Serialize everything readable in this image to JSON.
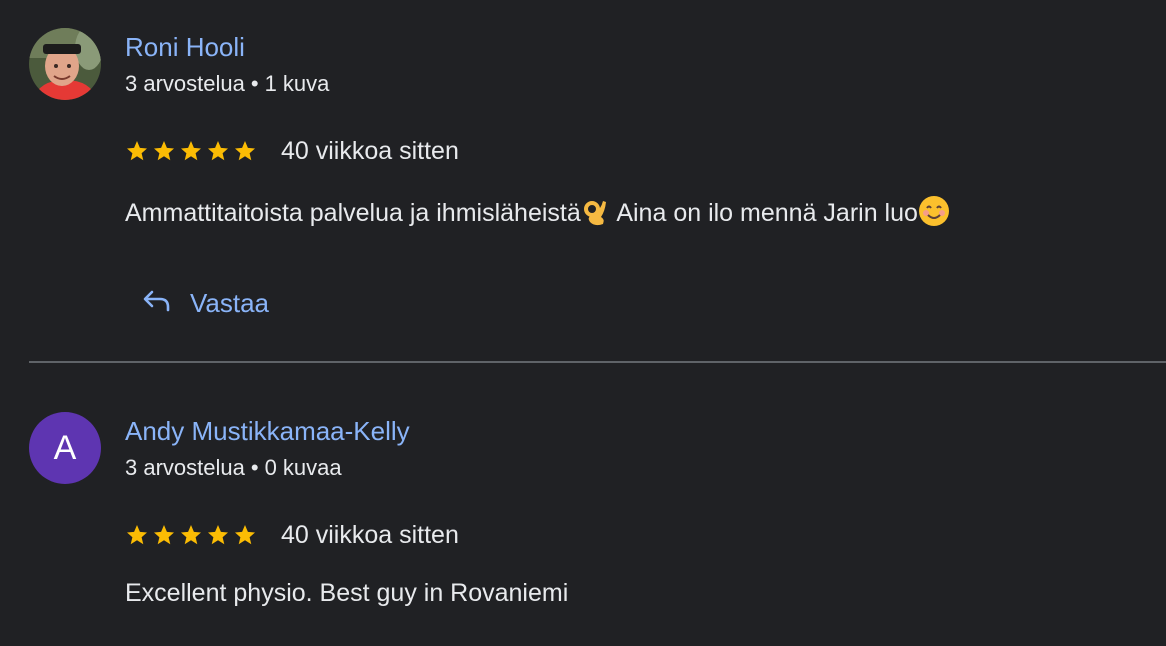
{
  "reviews": [
    {
      "author": "Roni Hooli",
      "reviews_count": "3 arvostelua",
      "separator": "•",
      "photos_count": "1 kuva",
      "rating": 5,
      "date": "40 viikkoa sitten",
      "text_before": "Ammattitaitoista palvelua ja ihmisläheistä",
      "text_mid": " Aina on ilo mennä Jarin luo",
      "emoji_1": "ok-hand-emoji",
      "emoji_2": "smiling-face-emoji",
      "avatar_type": "photo",
      "reply_label": "Vastaa"
    },
    {
      "author": "Andy Mustikkamaa-Kelly",
      "reviews_count": "3 arvostelua",
      "separator": "•",
      "photos_count": "0 kuvaa",
      "rating": 5,
      "date": "40 viikkoa sitten",
      "text": "Excellent physio. Best guy in Rovaniemi",
      "avatar_type": "letter",
      "avatar_letter": "A",
      "avatar_color": "#5e35b1"
    }
  ],
  "colors": {
    "background": "#202124",
    "link": "#8ab4f8",
    "text": "#e8eaed",
    "star": "#fbbc04",
    "divider": "#5f6368"
  }
}
